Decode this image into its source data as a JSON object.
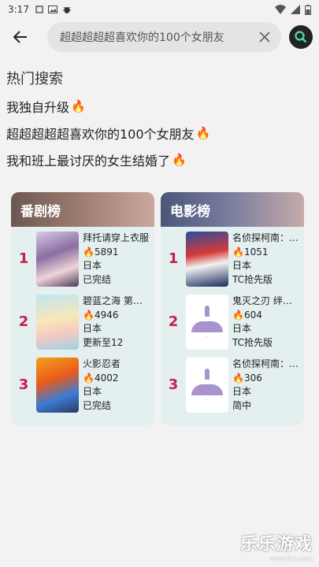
{
  "status": {
    "time": "3:17"
  },
  "search": {
    "value": "超超超超超喜欢你的100个女朋友",
    "placeholder": ""
  },
  "hot": {
    "title": "热门搜索",
    "items": [
      {
        "label": "我独自升级"
      },
      {
        "label": "超超超超超喜欢你的100个女朋友"
      },
      {
        "label": "我和班上最讨厌的女生结婚了"
      }
    ]
  },
  "drama": {
    "title": "番剧榜",
    "rows": [
      {
        "rank": "1",
        "name": "拜托请穿上衣服",
        "heat": "5891",
        "region": "日本",
        "status": "已完结"
      },
      {
        "rank": "2",
        "name": "碧蓝之海 第二季",
        "heat": "4946",
        "region": "日本",
        "status": "更新至12"
      },
      {
        "rank": "3",
        "name": "火影忍者",
        "heat": "4002",
        "region": "日本",
        "status": "已完结"
      }
    ]
  },
  "movie": {
    "title": "电影榜",
    "rows": [
      {
        "rank": "1",
        "name": "名侦探柯南：百万美元的五棱星",
        "heat": "1051",
        "region": "日本",
        "status": "TC抢先版"
      },
      {
        "rank": "2",
        "name": "鬼灭之刃 绊之奇迹",
        "heat": "604",
        "region": "日本",
        "status": "TC抢先版"
      },
      {
        "rank": "3",
        "name": "名侦探柯南：黑铁的鱼影",
        "heat": "306",
        "region": "日本",
        "status": "简中"
      }
    ]
  },
  "watermark": {
    "main": "乐乐游戏",
    "sub": "www.61t.com"
  },
  "colors": {
    "rank": "#c81e4a",
    "fire": "#f26522",
    "card_bg": "#e4efef"
  }
}
